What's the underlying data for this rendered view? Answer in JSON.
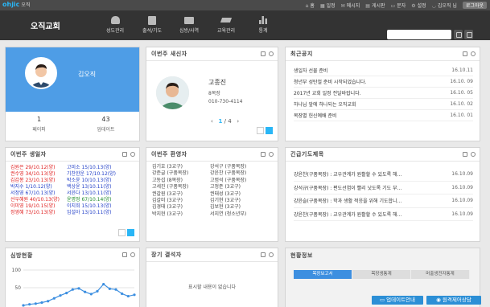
{
  "topbar": {
    "logo": "ohjic",
    "logo_sub": "오직",
    "links": [
      "홈",
      "일정",
      "메시지",
      "게시판",
      "문자",
      "설정",
      "김오직 님"
    ],
    "logout": "로그아웃"
  },
  "header": {
    "church_name": "오직교회",
    "nav": [
      "성도관리",
      "출석/기도",
      "심방/사역",
      "교육관리",
      "통계"
    ],
    "search_placeholder": ""
  },
  "profile": {
    "name": "김오직",
    "stats": [
      {
        "value": "1",
        "label": "페이퍼"
      },
      {
        "value": "43",
        "label": "업데이트"
      }
    ]
  },
  "new_member": {
    "title": "이번주 새신자",
    "name": "고종진",
    "group": "8목장",
    "phone": "010-730-4114",
    "page_current": "1",
    "page_total": "/ 4"
  },
  "notice": {
    "title": "최근공지",
    "items": [
      {
        "text": "생일자 선물 준비",
        "date": "16.10.11"
      },
      {
        "text": "청년부 성탄절 준비 시작되었습니다.",
        "date": "16.10. 09"
      },
      {
        "text": "2017년 교회 일정 전달바랍니다.",
        "date": "16.10. 05"
      },
      {
        "text": "하나님 앞에 하나되는 오직교회",
        "date": "16.10. 02"
      },
      {
        "text": "목장별 헌신예배 준비",
        "date": "16.10. 01"
      }
    ]
  },
  "birthdays": {
    "title": "이번주 생일자",
    "col1": [
      {
        "text": "김원은 29/10.12(양)",
        "color": "red"
      },
      {
        "text": "권수영 34/10.13(양)",
        "color": "red"
      },
      {
        "text": "김갑봉 23/10.13(양)",
        "color": "red"
      },
      {
        "text": "박지수 1/10.12(양)",
        "color": "blue"
      },
      {
        "text": "서정영 67/10.13(양)",
        "color": "blue"
      },
      {
        "text": "선우혜원 40/10.13(양)",
        "color": "red"
      },
      {
        "text": "이미영 19/10.15(양)",
        "color": "red"
      },
      {
        "text": "정영혜 73/10.13(양)",
        "color": "red"
      }
    ],
    "col2": [
      {
        "text": "고미소 15/10.13(양)",
        "color": "blue"
      },
      {
        "text": "기찬한운 17/10.12(양)",
        "color": "blue"
      },
      {
        "text": "박소윤 10/10.13(양)",
        "color": "blue"
      },
      {
        "text": "백상윤 13/10.11(양)",
        "color": "blue"
      },
      {
        "text": "서윤다 13/10.11(양)",
        "color": "blue"
      },
      {
        "text": "윤명정 67/10.14(양)",
        "color": "green"
      },
      {
        "text": "이지희 15/10.13(양)",
        "color": "blue"
      },
      {
        "text": "임설아 13/10.11(양)",
        "color": "blue"
      }
    ]
  },
  "visitors": {
    "title": "이번주 환영자",
    "col1": [
      "김기호 (3교구)",
      "강준글 (구품목장)",
      "고동섭 (8목장)",
      "고세진 (구품목장)",
      "권갈원 (3교구)",
      "김갈미 (3교구)",
      "김경태 (3교구)",
      "박지현 (3교구)"
    ],
    "col2": [
      "강석구 (구품목장)",
      "강윤찬 (구품목장)",
      "고범석 (구품목장)",
      "고정준 (3교구)",
      "권태성 (3교구)",
      "김기현 (3교구)",
      "김보현 (3교구)",
      "서지연 (청소년부)"
    ]
  },
  "prayer": {
    "title": "긴급기도제목",
    "items": [
      {
        "text": "강윤찬(구품목장) : 교우관계가 원활할 수 있도록 해...",
        "date": "16.10.09"
      },
      {
        "text": "강석규(구품목장) : 편도선염이 빨리 낫도록 기도 부...",
        "date": "16.10.09"
      },
      {
        "text": "강윤슬(구품목장) : 학과 생활 적응을 위해 기도합니...",
        "date": "16.10.09"
      },
      {
        "text": "강윤찬(구품목장) : 교우관계가 원활할 수 있도록 해...",
        "date": "16.10.09"
      }
    ]
  },
  "visit_status": {
    "title": "심방현황",
    "chart_data": {
      "type": "line",
      "title": "",
      "ylim": [
        0,
        100
      ],
      "yticks": [
        "100",
        "50"
      ],
      "series": [
        {
          "values": [
            0,
            3,
            5,
            8,
            12,
            20,
            28,
            35,
            45,
            48,
            38,
            32,
            40,
            60,
            47,
            45,
            33,
            26,
            30
          ]
        }
      ],
      "grid": true,
      "color": "#3d8fe0"
    }
  },
  "absent": {
    "title": "장기 결석자",
    "empty_text": "표시할 내용이 없습니다"
  },
  "status": {
    "title": "현황정보",
    "tabs": [
      "목장보고서",
      "목장생통계",
      "머출생전자통계"
    ]
  },
  "bottom": {
    "update_info": "업데이트안내",
    "remote_support": "원격제어상담"
  }
}
